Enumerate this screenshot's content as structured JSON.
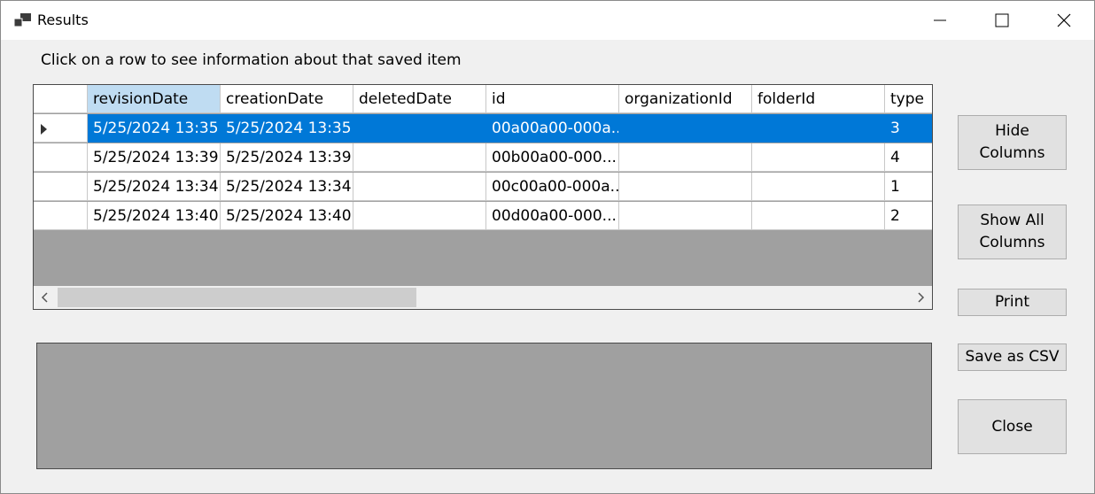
{
  "window": {
    "title": "Results"
  },
  "instructions": "Click on a row to see information about that saved item",
  "grid": {
    "columns": [
      "revisionDate",
      "creationDate",
      "deletedDate",
      "id",
      "organizationId",
      "folderId",
      "type"
    ],
    "rows": [
      [
        "5/25/2024 13:35",
        "5/25/2024 13:35",
        "",
        "00a00a00-000a...",
        "",
        "",
        "3"
      ],
      [
        "5/25/2024 13:39",
        "5/25/2024 13:39",
        "",
        "00b00a00-000...",
        "",
        "",
        "4"
      ],
      [
        "5/25/2024 13:34",
        "5/25/2024 13:34",
        "",
        "00c00a00-000a...",
        "",
        "",
        "1"
      ],
      [
        "5/25/2024 13:40",
        "5/25/2024 13:40",
        "",
        "00d00a00-000...",
        "",
        "",
        "2"
      ]
    ],
    "selected_row": 0,
    "active_header": 0
  },
  "buttons": {
    "hide_columns": "Hide\nColumns",
    "show_all_columns": "Show All\nColumns",
    "print": "Print",
    "save_csv": "Save as CSV",
    "close": "Close"
  }
}
